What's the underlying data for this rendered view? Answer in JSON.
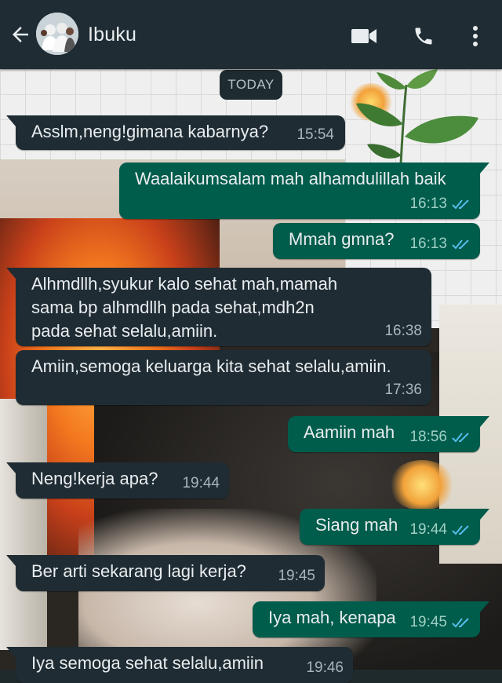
{
  "header": {
    "contact_name": "Ibuku",
    "icons": [
      "back-arrow-icon",
      "contact-avatar",
      "video-call-icon",
      "voice-call-icon",
      "more-options-icon"
    ]
  },
  "date_chip": "TODAY",
  "colors": {
    "header_bg": "#1f2c33",
    "incoming_bubble": "#1f2c33",
    "outgoing_bubble": "#005c4b",
    "read_tick": "#53bdeb"
  },
  "messages": [
    {
      "dir": "in",
      "text": "Asslm,neng!gimana kabarnya?",
      "time": "15:54"
    },
    {
      "dir": "out",
      "text": "Waalaikumsalam mah alhamdulillah baik",
      "time": "16:13",
      "status": "read"
    },
    {
      "dir": "out",
      "text": "Mmah gmna?",
      "time": "16:13",
      "status": "read"
    },
    {
      "dir": "in",
      "text": "Alhmdllh,syukur kalo sehat mah,mamah sama bp alhmdllh pada sehat,mdh2n pada sehat selalu,amiin.",
      "time": "16:38"
    },
    {
      "dir": "in",
      "text": "Amiin,semoga keluarga kita sehat selalu,amiin.",
      "time": "17:36"
    },
    {
      "dir": "out",
      "text": "Aamiin mah",
      "time": "18:56",
      "status": "read"
    },
    {
      "dir": "in",
      "text": "Neng!kerja apa?",
      "time": "19:44"
    },
    {
      "dir": "out",
      "text": "Siang mah",
      "time": "19:44",
      "status": "read"
    },
    {
      "dir": "in",
      "text": "Ber arti sekarang lagi kerja?",
      "time": "19:45"
    },
    {
      "dir": "out",
      "text": "Iya mah, kenapa",
      "time": "19:45",
      "status": "read"
    },
    {
      "dir": "in",
      "text": "Iya semoga sehat selalu,amiin",
      "time": "19:46"
    }
  ]
}
